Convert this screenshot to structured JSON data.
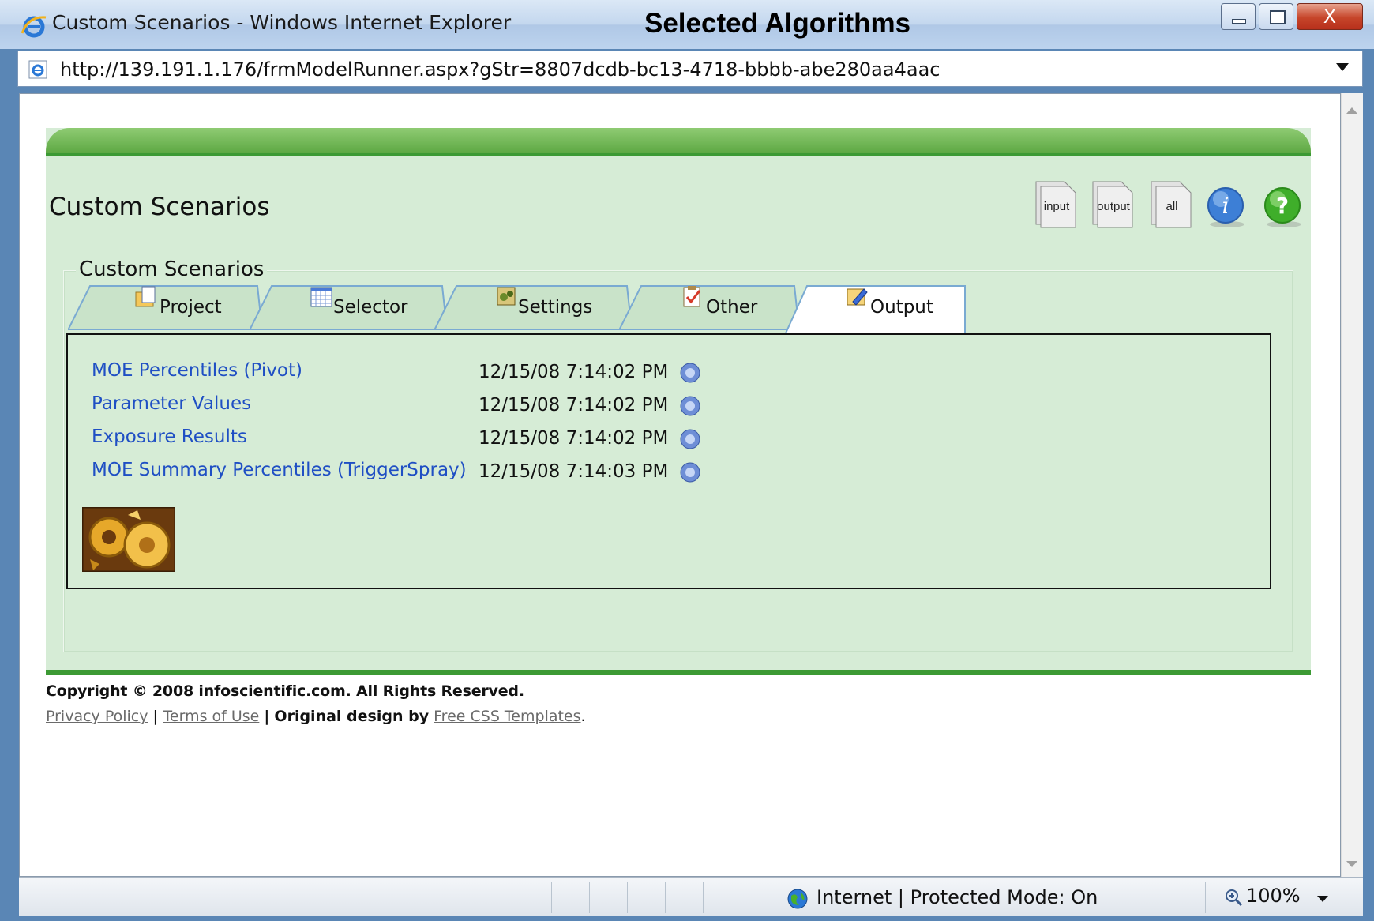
{
  "window": {
    "title": "Custom Scenarios - Windows Internet Explorer",
    "close_glyph": "X"
  },
  "overlay_title": "Selected Algorithms",
  "address": {
    "url": "http://139.191.1.176/frmModelRunner.aspx?gStr=8807dcdb-bc13-4718-bbbb-abe280aa4aac"
  },
  "page": {
    "title": "Custom Scenarios",
    "toolbar": {
      "input_label": "input",
      "output_label": "output",
      "all_label": "all"
    },
    "fieldset_legend": "Custom Scenarios",
    "tabs": [
      {
        "label": "Project",
        "icon": "project-icon",
        "active": false
      },
      {
        "label": "Selector",
        "icon": "calendar-grid-icon",
        "active": false
      },
      {
        "label": "Settings",
        "icon": "settings-icon",
        "active": false
      },
      {
        "label": "Other",
        "icon": "clipboard-check-icon",
        "active": false
      },
      {
        "label": "Output",
        "icon": "output-edit-icon",
        "active": true
      }
    ],
    "outputs": [
      {
        "name": "MOE Percentiles (Pivot)",
        "timestamp": "12/15/08 7:14:02 PM"
      },
      {
        "name": "Parameter Values",
        "timestamp": "12/15/08 7:14:02 PM"
      },
      {
        "name": "Exposure Results",
        "timestamp": "12/15/08 7:14:02 PM"
      },
      {
        "name": "MOE Summary Percentiles (TriggerSpray)",
        "timestamp": "12/15/08 7:14:03 PM"
      }
    ]
  },
  "footer": {
    "copyright": "Copyright © 2008 infoscientific.com. All Rights Reserved.",
    "privacy": "Privacy Policy",
    "terms": "Terms of Use",
    "separator": "|",
    "design_text": "Original design by",
    "templates": "Free CSS Templates",
    "end": "."
  },
  "statusbar": {
    "zone": "Internet | Protected Mode: On",
    "zoom": "100%"
  },
  "colors": {
    "page_bg": "#d6ecd6",
    "header_green": "#5aa640",
    "link_blue": "#1f4fc4"
  }
}
